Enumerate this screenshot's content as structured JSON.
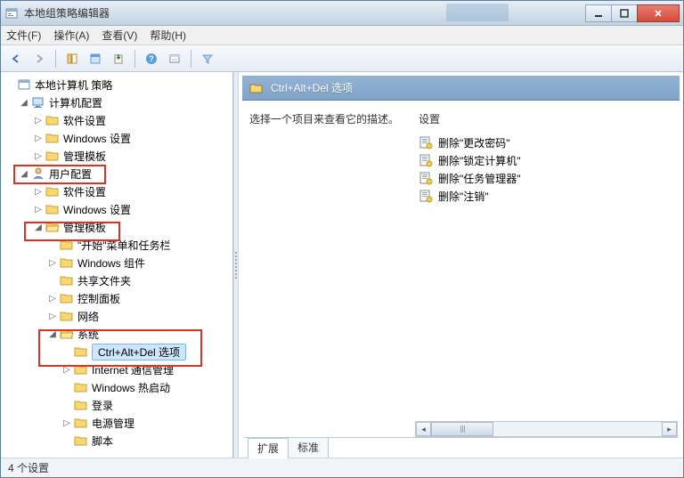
{
  "window": {
    "title": "本地组策略编辑器"
  },
  "menubar": [
    "文件(F)",
    "操作(A)",
    "查看(V)",
    "帮助(H)"
  ],
  "tree": {
    "root": "本地计算机 策略",
    "computer": {
      "label": "计算机配置",
      "children": [
        "软件设置",
        "Windows 设置",
        "管理模板"
      ]
    },
    "user": {
      "label": "用户配置",
      "software": "软件设置",
      "windows": "Windows 设置",
      "templates": {
        "label": "管理模板",
        "start": "\"开始\"菜单和任务栏",
        "components": "Windows 组件",
        "shared": "共享文件夹",
        "control": "控制面板",
        "network": "网络",
        "system": {
          "label": "系统",
          "cad": "Ctrl+Alt+Del 选项",
          "internet": "Internet 通信管理",
          "hotboot": "Windows 热启动",
          "login": "登录",
          "power": "电源管理",
          "script": "脚本"
        }
      }
    }
  },
  "right": {
    "title": "Ctrl+Alt+Del 选项",
    "desc": "选择一个项目来查看它的描述。",
    "settings_header": "设置",
    "settings": [
      "删除\"更改密码\"",
      "删除\"锁定计算机\"",
      "删除\"任务管理器\"",
      "删除\"注销\""
    ],
    "tabs": {
      "extended": "扩展",
      "standard": "标准"
    }
  },
  "status": "4 个设置"
}
